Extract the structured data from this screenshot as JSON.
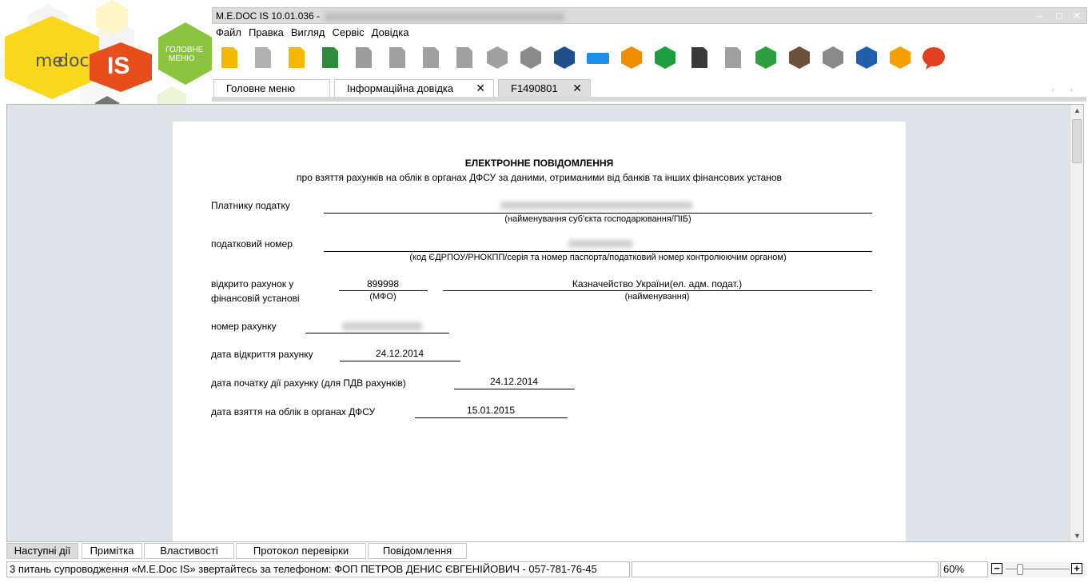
{
  "window": {
    "title": "M.E.DOC IS 10.01.036 -",
    "logo_text": "me doc IS",
    "logo_brand_left": "me",
    "logo_brand_mid": "doc",
    "logo_brand_right": "IS",
    "main_menu_tile": "ГОЛОВНЕ МЕНЮ",
    "main_menu_tile_line1": "ГОЛОВНЕ",
    "main_menu_tile_line2": "МЕНЮ",
    "minimize_glyph": "–",
    "maximize_glyph": "□",
    "close_glyph": "✕"
  },
  "menu": [
    "Файл",
    "Правка",
    "Вигляд",
    "Сервіс",
    "Довідка"
  ],
  "toolbar_icons": [
    {
      "name": "new-document-icon",
      "color": "#f5b800"
    },
    {
      "name": "open-folder-icon",
      "color": "#b0b0b0"
    },
    {
      "name": "delete-document-icon",
      "color": "#f5b800"
    },
    {
      "name": "excel-export-icon",
      "color": "#2e8b3e"
    },
    {
      "name": "copy-document-icon",
      "color": "#9c9c9c"
    },
    {
      "name": "add-page-icon",
      "color": "#a0a0a0"
    },
    {
      "name": "search-page-icon",
      "color": "#a0a0a0"
    },
    {
      "name": "remove-page-icon",
      "color": "#a0a0a0"
    },
    {
      "name": "text-format-icon",
      "color": "#a0a0a0"
    },
    {
      "name": "cube-icon",
      "color": "#8a8a8a"
    },
    {
      "name": "image-icon",
      "color": "#1f4e8c"
    },
    {
      "name": "print-icon",
      "color": "#1f8ee8"
    },
    {
      "name": "mail-icon",
      "color": "#f08c00"
    },
    {
      "name": "key-icon",
      "color": "#1b9e3e"
    },
    {
      "name": "zoom-icon",
      "color": "#3a3a3a"
    },
    {
      "name": "check-document-icon",
      "color": "#a0a0a0"
    },
    {
      "name": "refresh-icon",
      "color": "#2e9e3e"
    },
    {
      "name": "calculator-icon",
      "color": "#6b4f3b"
    },
    {
      "name": "stamp-icon",
      "color": "#8a8a8a"
    },
    {
      "name": "calendar-icon",
      "color": "#1f5eaa"
    },
    {
      "name": "help-icon",
      "color": "#f5a000"
    },
    {
      "name": "chat-icon",
      "color": "#e04020"
    }
  ],
  "tabs": [
    {
      "label": "Головне меню",
      "closable": false
    },
    {
      "label": "Інформаційна довідка",
      "closable": true,
      "close_glyph": "✕"
    },
    {
      "label": "F1490801",
      "closable": true,
      "active": true,
      "close_glyph": "✕"
    }
  ],
  "document": {
    "title": "ЕЛЕКТРОННЕ ПОВІДОМЛЕННЯ",
    "subtitle": "про взяття рахунків на облік в органах ДФСУ за даними, отриманими від банків та інших фінансових установ",
    "payer_label": "Платнику податку",
    "payer_hint": "(найменування суб'єкта господарювання/ПІБ)",
    "tax_number_label": "податковий номер",
    "tax_number_hint": "(код ЄДРПОУ/РНОКПП/серія та номер паспорта/податковий номер контролюючим органом)",
    "account_opened_label_1": "відкрито рахунок у",
    "account_opened_label_2": "фінансовій установі",
    "mfo_value": "899998",
    "mfo_hint": "(МФО)",
    "institution_value": "Казначейство України(ел. адм. подат.)",
    "institution_hint": "(найменування)",
    "account_number_label": "номер рахунку",
    "open_date_label": "дата відкриття рахунку",
    "open_date_value": "24.12.2014",
    "vat_start_label": "дата початку дії рахунку (для ПДВ рахунків)",
    "vat_start_value": "24.12.2014",
    "registration_label": "дата взяття на облік в органах ДФСУ",
    "registration_value": "15.01.2015"
  },
  "bottom_tabs": [
    "Наступні дії",
    "Примітка",
    "Властивості",
    "Протокол перевірки",
    "Повідомлення"
  ],
  "statusbar": {
    "support_text": "3 питань супроводження «M.E.Doc IS» звертайтесь за телефоном: ФОП ПЕТРОВ ДЕНИС ЄВГЕНІЙОВИЧ - 057-781-76-45",
    "zoom": "60%",
    "zoom_minus": "−",
    "zoom_plus": "+"
  },
  "scroll": {
    "up_glyph": "▲",
    "down_glyph": "▼"
  },
  "tab_scroll": {
    "glyph": "‹ ›"
  }
}
